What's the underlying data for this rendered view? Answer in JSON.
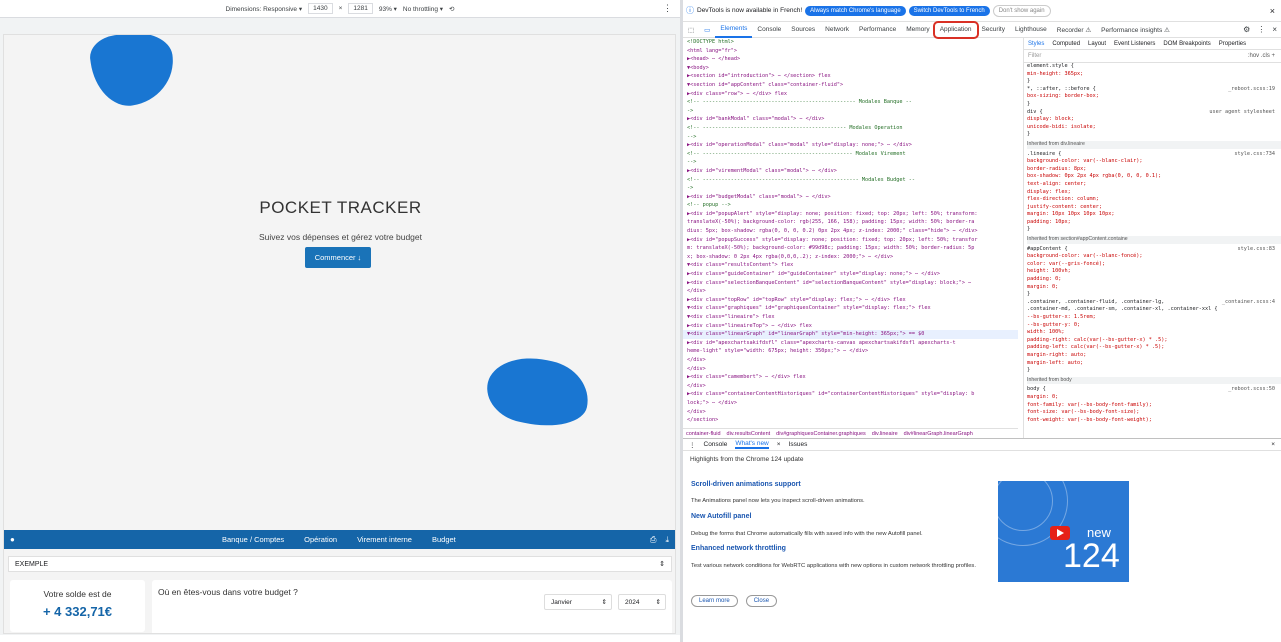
{
  "responsive_bar": {
    "dimensions_label": "Dimensions: Responsive ▾",
    "width": "1430",
    "x": "×",
    "height": "1281",
    "zoom": "93% ▾",
    "throttle": "No throttling ▾"
  },
  "app": {
    "title": "POCKET TRACKER",
    "subtitle": "Suivez vos dépenses et gérez votre budget",
    "cta": "Commencer",
    "nav": [
      "Banque / Comptes",
      "Opération",
      "Virement interne",
      "Budget"
    ],
    "account_select": "EXEMPLE",
    "balance_label": "Votre solde est de",
    "balance_value": "+ 4 332,71€",
    "budget_question": "Où en êtes-vous dans votre budget ?",
    "month": "Janvier",
    "year": "2024"
  },
  "devtools": {
    "infobar": {
      "text": "DevTools is now available in French!",
      "btn1": "Always match Chrome's language",
      "btn2": "Switch DevTools to French",
      "btn3": "Don't show again"
    },
    "tabs": [
      "Elements",
      "Console",
      "Sources",
      "Network",
      "Performance",
      "Memory",
      "Application",
      "Security",
      "Lighthouse",
      "Recorder ⚠",
      "Performance insights ⚠"
    ],
    "elements": [
      {
        "t": "<!DOCTYPE html>",
        "c": true
      },
      {
        "t": "<html lang=\"fr\">"
      },
      {
        "t": "▶<head> ⋯ </head>"
      },
      {
        "t": "▼<body>"
      },
      {
        "t": "  ▶<section id=\"introduction\"> ⋯ </section> flex"
      },
      {
        "t": "  ▼<section id=\"appContent\" class=\"container-fluid\">"
      },
      {
        "t": "    ▶<div class=\"row\"> ⋯ </div> flex"
      },
      {
        "t": "    <!-- ------------------------------------------------- Modales Banque --",
        "c": true
      },
      {
        "t": "    ->",
        "c": true
      },
      {
        "t": "    ▶<div id=\"bankModal\" class=\"modal\"> ⋯ </div>"
      },
      {
        "t": "    <!-- ---------------------------------------------- Modales Operation",
        "c": true
      },
      {
        "t": "    -->",
        "c": true
      },
      {
        "t": "    ▶<div id=\"operationModal\" class=\"modal\" style=\"display: none;\"> ⋯ </div>"
      },
      {
        "t": "    <!-- ------------------------------------------------ Modales Virement",
        "c": true
      },
      {
        "t": "    -->",
        "c": true
      },
      {
        "t": "    ▶<div id=\"virementModal\" class=\"modal\"> ⋯ </div>"
      },
      {
        "t": "    <!-- -------------------------------------------------- Modales Budget --",
        "c": true
      },
      {
        "t": "    ->",
        "c": true
      },
      {
        "t": "    ▶<div id=\"budgetModal\" class=\"modal\"> ⋯ </div>"
      },
      {
        "t": "    <!-- popup -->",
        "c": true
      },
      {
        "t": "    ▶<div id=\"popupAlert\" style=\"display: none; position: fixed; top: 20px; left: 50%; transform:"
      },
      {
        "t": "     translateX(-50%); background-color: rgb(255, 166, 158); padding: 15px; width: 50%; border-ra"
      },
      {
        "t": "     dius: 5px; box-shadow: rgba(0, 0, 0, 0.2) 0px 2px 4px; z-index: 2000;\" class=\"hide\"> ⋯ </div>"
      },
      {
        "t": "    ▶<div id=\"popupSuccess\" style=\"display: none; position: fixed; top: 20px; left: 50%; transfor"
      },
      {
        "t": "     m: translateX(-50%); background-color: #99d98c; padding: 15px; width: 50%; border-radius: 5p"
      },
      {
        "t": "     x; box-shadow: 0 2px 4px rgba(0,0,0,.2); z-index: 2000;\"> ⋯ </div>"
      },
      {
        "t": "    ▼<div class=\"resultsContent\"> flex"
      },
      {
        "t": "      ▶<div class=\"guideContainer\" id=\"guideContainer\" style=\"display: none;\"> ⋯ </div>"
      },
      {
        "t": "      ▶<div class=\"selectionBanqueContent\" id=\"selectionBanqueContent\" style=\"display: block;\"> ⋯"
      },
      {
        "t": "       </div>"
      },
      {
        "t": "      ▶<div class=\"topRow\" id=\"topRow\" style=\"display: flex;\"> ⋯ </div> flex"
      },
      {
        "t": "      ▼<div class=\"graphiques\" id=\"graphiquesContainer\" style=\"display: flex;\"> flex"
      },
      {
        "t": "        ▼<div class=\"lineaire\"> flex"
      },
      {
        "t": "          ▶<div class=\"lineaireTop\"> ⋯ </div> flex"
      },
      {
        "t": "          ▼<div class=\"linearGraph\" id=\"linearGraph\" style=\"min-height: 365px;\"> == $0",
        "s": true
      },
      {
        "t": "            ▶<div id=\"apexchartsakifdsfl\" class=\"apexcharts-canvas apexchartsakifdsfl apexcharts-t"
      },
      {
        "t": "             heme-light\" style=\"width: 675px; height: 350px;\"> ⋯ </div>"
      },
      {
        "t": "           </div>"
      },
      {
        "t": "          </div>"
      },
      {
        "t": "        ▶<div class=\"camembert\"> ⋯ </div> flex"
      },
      {
        "t": "       </div>"
      },
      {
        "t": "      ▶<div class=\"containerContentHistoriques\" id=\"containerContentHistoriques\" style=\"display: b"
      },
      {
        "t": "       lock;\"> ⋯ </div>"
      },
      {
        "t": "     </div>"
      },
      {
        "t": "   </section>"
      }
    ],
    "breadcrumbs": [
      "container-fluid",
      "div.resultsContent",
      "div#graphiquesContainer.graphiques",
      "div.lineaire",
      "div#linearGraph.linearGraph"
    ],
    "styles_tabs": [
      "Styles",
      "Computed",
      "Layout",
      "Event Listeners",
      "DOM Breakpoints",
      "Properties"
    ],
    "filter": "Filter",
    "filter_tools": ":hov  .cls  +",
    "rules": [
      {
        "t": "element.style {"
      },
      {
        "t": "  min-height: 365px;",
        "p": true
      },
      {
        "t": "}"
      },
      {
        "t": "*, ::after, ::before {",
        "src": "_reboot.scss:19"
      },
      {
        "t": "  box-sizing: border-box;",
        "p": true
      },
      {
        "t": "}"
      },
      {
        "t": "div {",
        "src": "user agent stylesheet"
      },
      {
        "t": "  display: block;",
        "p": true
      },
      {
        "t": "  unicode-bidi: isolate;",
        "p": true
      },
      {
        "t": "}"
      },
      {
        "t": "Inherited from div.lineaire",
        "inh": true
      },
      {
        "t": ".lineaire {",
        "src": "style.css:734"
      },
      {
        "t": "  background-color: var(--blanc-clair);",
        "p": true
      },
      {
        "t": "  border-radius: 8px;",
        "p": true
      },
      {
        "t": "  box-shadow: 0px 2px 4px rgba(0, 0, 0, 0.1);",
        "p": true
      },
      {
        "t": "  text-align: center;",
        "p": true
      },
      {
        "t": "  display: flex;",
        "p": true
      },
      {
        "t": "  flex-direction: column;",
        "p": true
      },
      {
        "t": "  justify-content: center;",
        "p": true
      },
      {
        "t": "  margin: 10px 10px 10px 10px;",
        "p": true
      },
      {
        "t": "  padding: 10px;",
        "p": true
      },
      {
        "t": "}"
      },
      {
        "t": "Inherited from section#appContent.containe",
        "inh": true
      },
      {
        "t": "#appContent {",
        "src": "style.css:83"
      },
      {
        "t": "  background-color: var(--blanc-foncé);",
        "p": true
      },
      {
        "t": "  color: var(--gris-foncé);",
        "p": true
      },
      {
        "t": "  height: 100vh;",
        "p": true
      },
      {
        "t": "  padding: 0;",
        "p": true
      },
      {
        "t": "  margin: 0;",
        "p": true
      },
      {
        "t": "}"
      },
      {
        "t": ".container, .container-fluid, .container-lg,",
        "src": "_container.scss:4"
      },
      {
        "t": ".container-md, .container-sm, .container-xl, .container-xxl {"
      },
      {
        "t": "  --bs-gutter-x: 1.5rem;",
        "p": true
      },
      {
        "t": "  --bs-gutter-y: 0;",
        "p": true
      },
      {
        "t": "  width: 100%;",
        "p": true
      },
      {
        "t": "  padding-right: calc(var(--bs-gutter-x) * .5);",
        "p": true
      },
      {
        "t": "  padding-left: calc(var(--bs-gutter-x) * .5);",
        "p": true
      },
      {
        "t": "  margin-right: auto;",
        "p": true
      },
      {
        "t": "  margin-left: auto;",
        "p": true
      },
      {
        "t": "}"
      },
      {
        "t": "Inherited from body",
        "inh": true
      },
      {
        "t": "body {",
        "src": "_reboot.scss:50"
      },
      {
        "t": "  margin: 0;",
        "p": true
      },
      {
        "t": "  font-family: var(--bs-body-font-family);",
        "p": true
      },
      {
        "t": "  font-size: var(--bs-body-font-size);",
        "p": true
      },
      {
        "t": "  font-weight: var(--bs-body-font-weight);",
        "p": true
      }
    ],
    "drawer_tabs": [
      "Console",
      "What's new",
      "Issues"
    ],
    "highlights": "Highlights from the Chrome 124 update",
    "features": [
      {
        "title": "Scroll-driven animations support",
        "desc": "The Animations panel now lets you inspect scroll-driven animations."
      },
      {
        "title": "New Autofill panel",
        "desc": "Debug the forms that Chrome automatically fills with saved info with the new Autofill panel."
      },
      {
        "title": "Enhanced network throttling",
        "desc": "Test various network conditions for WebRTC applications with new options in custom network throttling profiles."
      }
    ],
    "learn_more": "Learn more",
    "close": "Close",
    "video_new": "new",
    "video_version": "124"
  },
  "colors": {
    "accent": "#1a73e8",
    "app_blue": "#1565a8",
    "highlight_red": "#d93025"
  }
}
